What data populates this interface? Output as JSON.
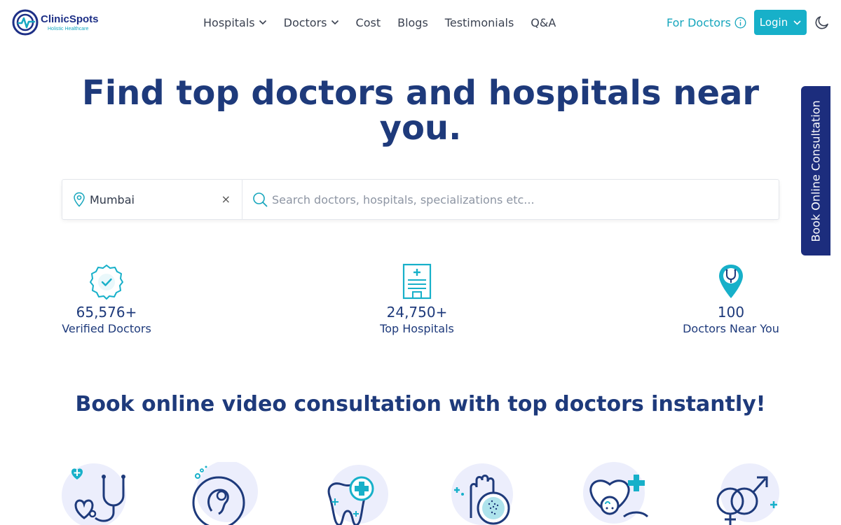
{
  "brand": {
    "name": "ClinicSpots",
    "tagline": "Holistic Healthcare"
  },
  "nav": {
    "items": [
      {
        "label": "Hospitals",
        "has_dropdown": true
      },
      {
        "label": "Doctors",
        "has_dropdown": true
      },
      {
        "label": "Cost",
        "has_dropdown": false
      },
      {
        "label": "Blogs",
        "has_dropdown": false
      },
      {
        "label": "Testimonials",
        "has_dropdown": false
      },
      {
        "label": "Q&A",
        "has_dropdown": false
      }
    ],
    "for_doctors": "For Doctors",
    "login": "Login"
  },
  "hero": {
    "title": "Find top doctors and hospitals near you."
  },
  "search": {
    "location_value": "Mumbai",
    "clear_symbol": "×",
    "placeholder": "Search doctors, hospitals, specializations etc..."
  },
  "side_tab": {
    "label": "Book Online Consultation"
  },
  "stats": [
    {
      "value": "65,576+",
      "label": "Verified Doctors",
      "icon": "verified-badge-icon"
    },
    {
      "value": "24,750+",
      "label": "Top Hospitals",
      "icon": "hospital-building-icon"
    },
    {
      "value": "100",
      "label": "Doctors Near You",
      "icon": "stethoscope-pin-icon"
    }
  ],
  "consult": {
    "title": "Book online video consultation with top doctors instantly!"
  },
  "specialties": [
    {
      "icon": "cardiology-stethoscope-icon"
    },
    {
      "icon": "pregnancy-fetus-icon"
    },
    {
      "icon": "dental-tooth-icon"
    },
    {
      "icon": "dermatology-magnifier-icon"
    },
    {
      "icon": "pediatrics-baby-icon"
    },
    {
      "icon": "sexology-gender-icon"
    }
  ],
  "colors": {
    "primary_navy": "#1e3a7b",
    "accent_teal": "#17b0c9",
    "side_tab_bg": "#1c2d7d",
    "icon_circle": "#eceefc"
  }
}
